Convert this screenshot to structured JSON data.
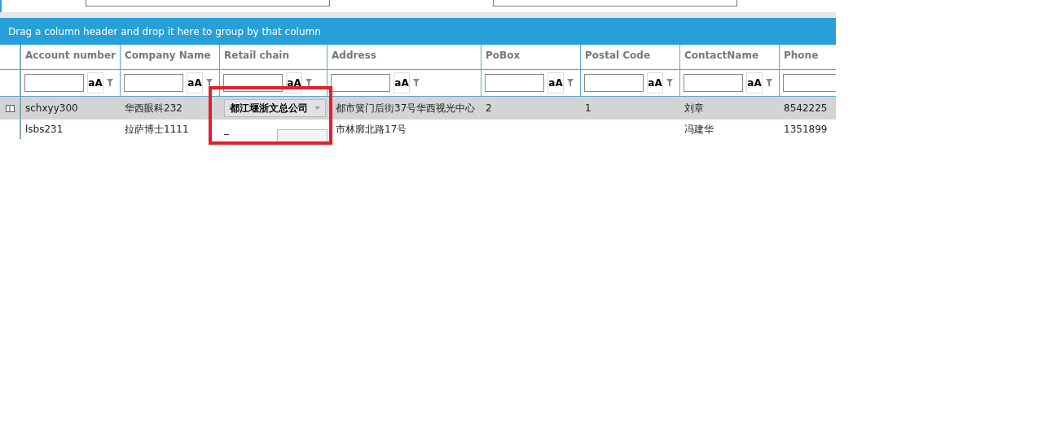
{
  "group_panel": {
    "hint": "Drag a column header and drop it here to group by that column"
  },
  "table": {
    "columns": [
      {
        "title": "Account number",
        "filter_button": "aA"
      },
      {
        "title": "Company Name",
        "filter_button": "aA"
      },
      {
        "title": "Retail chain",
        "filter_button": "aA"
      },
      {
        "title": "Address",
        "filter_button": "aA"
      },
      {
        "title": "PoBox",
        "filter_button": "aA"
      },
      {
        "title": "Postal Code",
        "filter_button": "aA"
      },
      {
        "title": "ContactName",
        "filter_button": "aA"
      },
      {
        "title": "Phone"
      }
    ],
    "rows": [
      {
        "selected": true,
        "cells": [
          "schxyy300",
          "华西眼科232",
          "都江堰浙文总公司",
          "都市簧门后街37号华西视光中心",
          "2",
          "1",
          "刘章",
          "8542225"
        ],
        "editing": true
      },
      {
        "selected": false,
        "cells": [
          "lsbs231",
          "拉萨博士1111",
          "_",
          "市林廓北路17号",
          "",
          "",
          "冯建华",
          "1351899"
        ],
        "editing": false
      }
    ]
  }
}
